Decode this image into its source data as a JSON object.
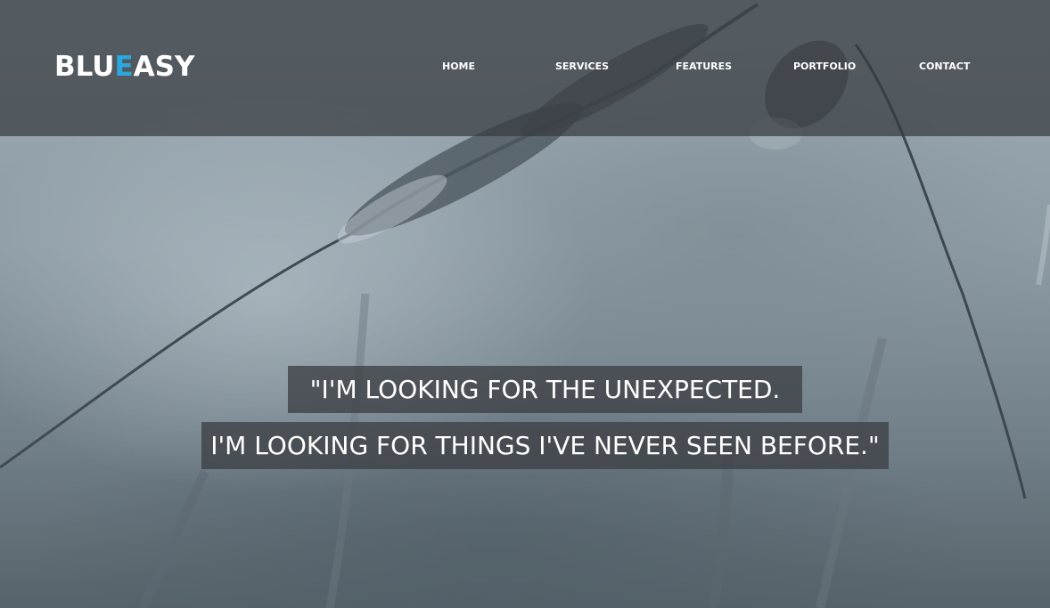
{
  "brand": {
    "logo_part1": "BLU",
    "logo_accent": "E",
    "logo_part2": "ASY",
    "accent_color": "#2aa9e0"
  },
  "nav": {
    "items": [
      {
        "label": "HOME"
      },
      {
        "label": "SERVICES"
      },
      {
        "label": "FEATURES"
      },
      {
        "label": "PORTFOLIO"
      },
      {
        "label": "CONTACT"
      }
    ]
  },
  "hero": {
    "background": "wheat-grass-photo",
    "quote_line1": "\"I'M LOOKING FOR THE UNEXPECTED.",
    "quote_line2": "I'M LOOKING FOR THINGS I'VE NEVER SEEN BEFORE.\""
  }
}
